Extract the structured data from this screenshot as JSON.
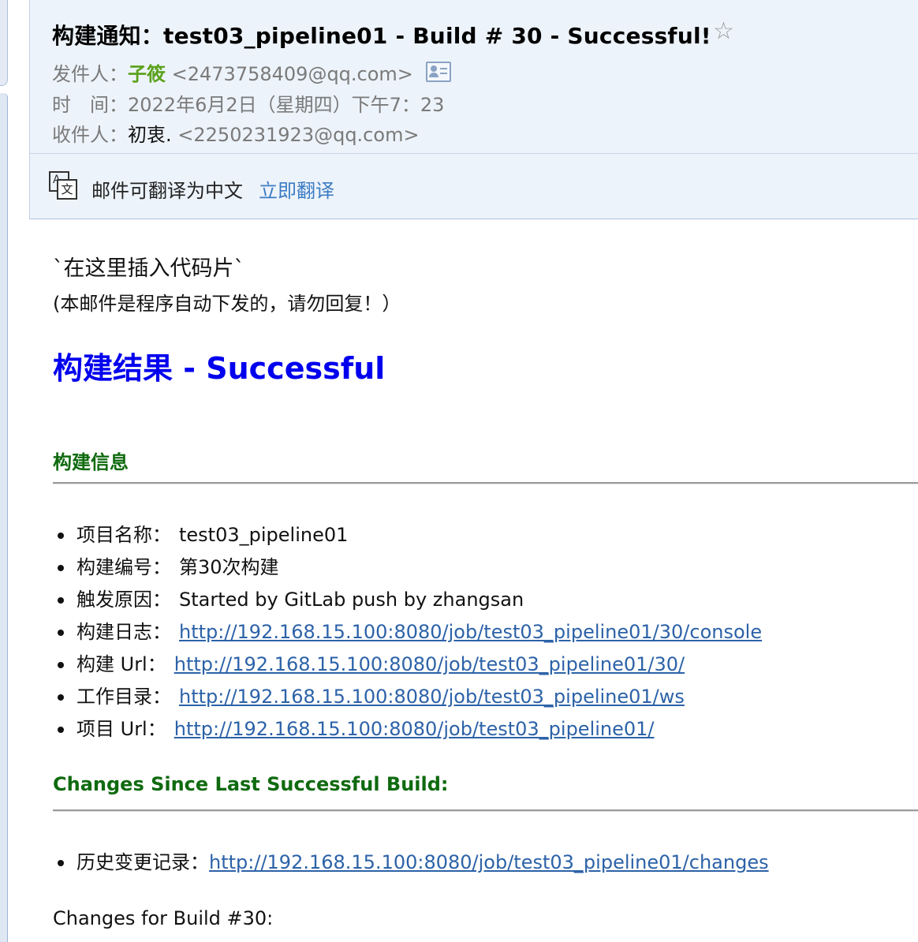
{
  "email": {
    "subject": "构建通知：test03_pipeline01 - Build # 30 - Successful!",
    "star_icon": "star-outline-icon",
    "sender_label": "发件人：",
    "sender_name": "子筱",
    "sender_email": "<2473758409@qq.com>",
    "time_label": "时　间：",
    "time_value": "2022年6月2日（星期四）下午7：23",
    "recipient_label": "收件人：",
    "recipient_name": "初衷.",
    "recipient_email": "<2250231923@qq.com>"
  },
  "translate_bar": {
    "text": "邮件可翻译为中文",
    "action": "立即翻译",
    "icon": "translate-icon"
  },
  "body": {
    "code_line": "`在这里插入代码片`",
    "notice": "(本邮件是程序自动下发的，请勿回复！）",
    "result_title": "构建结果 - Successful",
    "build_info_title": "构建信息",
    "build_info": [
      {
        "label": "项目名称：",
        "value": "test03_pipeline01"
      },
      {
        "label": "构建编号：",
        "value": "第30次构建"
      },
      {
        "label": "触发原因：",
        "value": "Started by GitLab push by zhangsan"
      },
      {
        "label": "构建日志：",
        "link": "http://192.168.15.100:8080/job/test03_pipeline01/30/console"
      },
      {
        "label": "构建 Url：",
        "link": "http://192.168.15.100:8080/job/test03_pipeline01/30/"
      },
      {
        "label": "工作目录：",
        "link": "http://192.168.15.100:8080/job/test03_pipeline01/ws"
      },
      {
        "label": "项目 Url：",
        "link": "http://192.168.15.100:8080/job/test03_pipeline01/"
      }
    ],
    "changes_title": "Changes Since Last Successful Build:",
    "history_label": "历史变更记录：",
    "history_link": "http://192.168.15.100:8080/job/test03_pipeline01/changes",
    "changes_for": "Changes for Build #30:"
  },
  "colors": {
    "sender_name": "#5aa11b",
    "result_title": "#0000ee",
    "section_title": "#0f6a0f",
    "link": "#2c62a8",
    "translate_link": "#3b7cc4",
    "header_bg": "#edf3fa"
  }
}
